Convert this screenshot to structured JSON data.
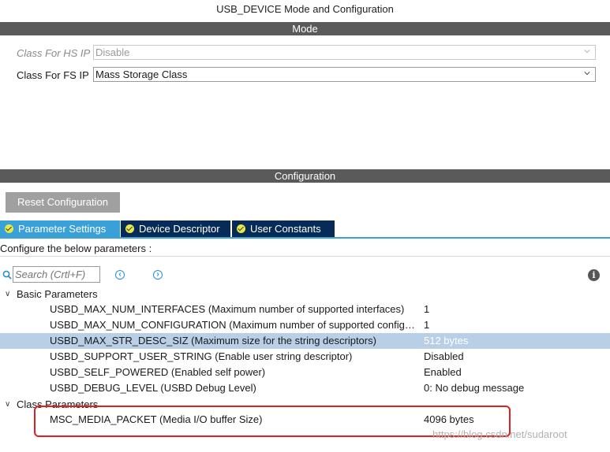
{
  "window": {
    "title": "USB_DEVICE Mode and Configuration"
  },
  "mode": {
    "header": "Mode",
    "hs_ip": {
      "label": "Class For HS IP",
      "value": "Disable"
    },
    "fs_ip": {
      "label": "Class For FS IP",
      "value": "Mass Storage Class"
    }
  },
  "configuration": {
    "header": "Configuration",
    "reset_label": "Reset Configuration",
    "tabs": [
      {
        "label": "Parameter Settings",
        "active": true
      },
      {
        "label": "Device Descriptor",
        "active": false
      },
      {
        "label": "User Constants",
        "active": false
      }
    ],
    "instruction": "Configure the below parameters :",
    "search_placeholder": "Search (Crtl+F)",
    "prev_icon": "chevron-left-circle-icon",
    "next_icon": "chevron-right-circle-icon",
    "info_icon": "info-icon",
    "groups": [
      {
        "name": "Basic Parameters",
        "params": [
          {
            "name": "USBD_MAX_NUM_INTERFACES (Maximum number of supported interfaces)",
            "value": "1"
          },
          {
            "name": "USBD_MAX_NUM_CONFIGURATION (Maximum number of supported configur...",
            "value": "1"
          },
          {
            "name": "USBD_MAX_STR_DESC_SIZ (Maximum size for the string descriptors)",
            "value": "512 bytes",
            "selected": true
          },
          {
            "name": "USBD_SUPPORT_USER_STRING (Enable user string descriptor)",
            "value": "Disabled"
          },
          {
            "name": "USBD_SELF_POWERED (Enabled self power)",
            "value": "Enabled"
          },
          {
            "name": "USBD_DEBUG_LEVEL (USBD Debug Level)",
            "value": "0: No debug message"
          }
        ]
      },
      {
        "name": "Class Parameters",
        "params": [
          {
            "name": "MSC_MEDIA_PACKET (Media I/O buffer Size)",
            "value": "4096 bytes"
          }
        ]
      }
    ]
  },
  "watermark": "https://blog.csdn.net/sudaroot",
  "colors": {
    "header_bar": "#5a5a5a",
    "tab_active": "#3aa0d8",
    "tab_inactive": "#072b57",
    "selected_row": "#b8cfe6",
    "highlight_box": "#e02020"
  }
}
